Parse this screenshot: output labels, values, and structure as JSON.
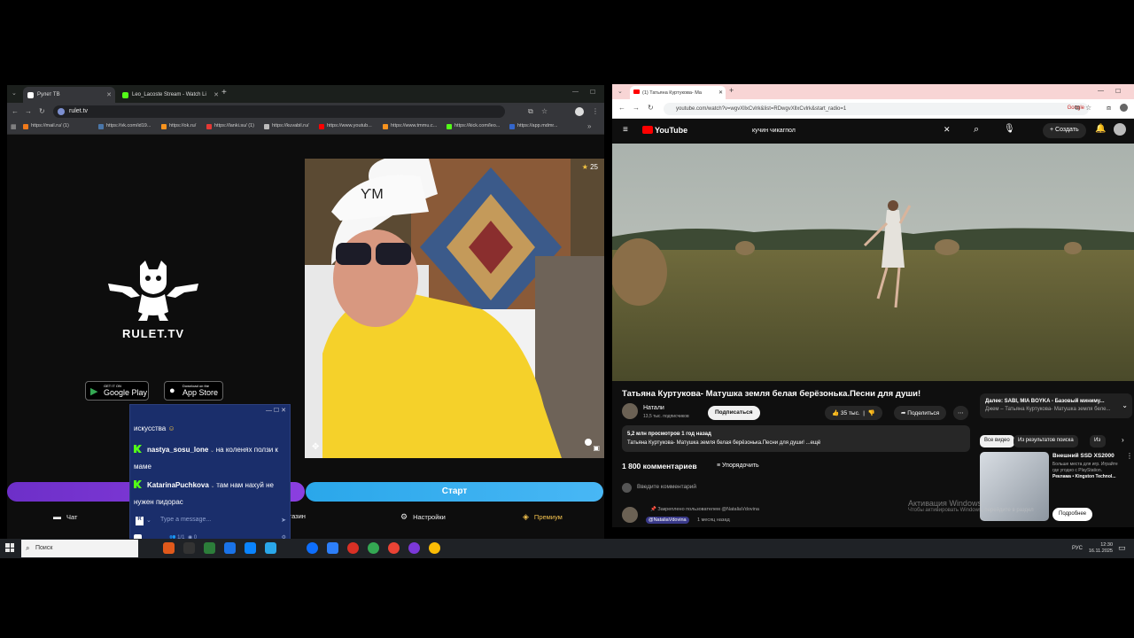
{
  "left_browser": {
    "tabs": [
      {
        "label": "Рулет ТВ",
        "favicon_color": "#ffffff"
      },
      {
        "label": "Leo_Lacoste Stream - Watch Li",
        "favicon_color": "#53fc18"
      }
    ],
    "address": "rulet.tv",
    "bookmarks": [
      {
        "label": "https://mail.ru/ (1)",
        "color": "#f07a1a"
      },
      {
        "label": "https://vk.com/id19...",
        "color": "#4a76a8"
      },
      {
        "label": "https://ok.ru/",
        "color": "#f7931e"
      },
      {
        "label": "https://lanki.su/ (1)",
        "color": "#e53935"
      },
      {
        "label": "https://kuvabil.ru/",
        "color": "#bbbbbb"
      },
      {
        "label": "https://www.youtub...",
        "color": "#ff0000"
      },
      {
        "label": "https://www.tmmu.c...",
        "color": "#f7931e"
      },
      {
        "label": "https://kick.com/leo...",
        "color": "#53fc18"
      },
      {
        "label": "https://app.mdmr...",
        "color": "#3366cc"
      }
    ],
    "brand_name": "RULET.TV",
    "google_play": {
      "small": "GET IT ON",
      "big": "Google Play"
    },
    "app_store": {
      "small": "Download on the",
      "big": "App Store"
    },
    "viewer_count": "25",
    "button_start": "Старт",
    "bottom_nav": {
      "chat": "Чат",
      "shop": "Магазин",
      "settings": "Настройки",
      "premium": "Премиум"
    },
    "accent_purple": "#7b38d8",
    "accent_blue": "#38afef"
  },
  "chat_popup": {
    "top_partial": "искусства",
    "messages": [
      {
        "user": "nastya_sosu_lone",
        "text": "на коленях ползи к маме"
      },
      {
        "user": "KatarinaPuchkova",
        "text": "там нам нахуй не нужен пидорас"
      }
    ],
    "placeholder": "Type a message...",
    "user_badge": "R",
    "footer": "1/1",
    "footer_views": "0",
    "kick_color": "#53fc18"
  },
  "right_browser": {
    "tab_label": "(1) Татьяна Куртукова- Ма",
    "address": "youtube.com/watch?v=wgvXllxCvlrk&list=RDwgvXllxCvlrk&start_radio=1",
    "google_label": "Google",
    "youtube_label": "YouTube",
    "search_query": "кучин чикагпол",
    "create_label": "Создать",
    "notifications": "9+",
    "video_title": "Татьяна Куртукова- Матушка земля белая берёзонька.Песни для души!",
    "channel": {
      "name": "Натали",
      "subs": "13,5 тыс. подписчиков"
    },
    "subscribe": "Подписаться",
    "likes": "35 тыс.",
    "share": "Поделиться",
    "description": {
      "stats": "5,2 млн просмотров  1 год назад",
      "text": "Татьяна Куртукова- Матушка земля белая берёзонька.Песни для души! ...ещё"
    },
    "comments_count": "1 800 комментариев",
    "sort_label": "Упорядочить",
    "add_comment": "Введите комментарий",
    "pinned": "Закреплено пользователем @NataliaVdovina",
    "pinned_user": "@NataliaVdovina",
    "pinned_time": "1 месяц назад",
    "next_up": {
      "title": "Далее: SABI, MIA BOYKA - Базовый миниму...",
      "sub": "Джем – Татьяна Куртукова- Матушка земля беле..."
    },
    "chips": [
      "Все видео",
      "Из результатов поиска",
      "Из"
    ],
    "ad": {
      "title": "Внешний SSD XS2000",
      "text": "Больше места для игр. Играйте где угодно с PlayStation.",
      "sponsor": "Реклама • Kingston Technol...",
      "button": "Подробнее"
    },
    "activation": {
      "title": "Активация Windows",
      "sub": "Чтобы активировать Windows, перейдите в раздел"
    }
  },
  "taskbar": {
    "search_placeholder": "Поиск",
    "lang": "РУС",
    "time": "12:30",
    "date": "16.11.2025"
  }
}
